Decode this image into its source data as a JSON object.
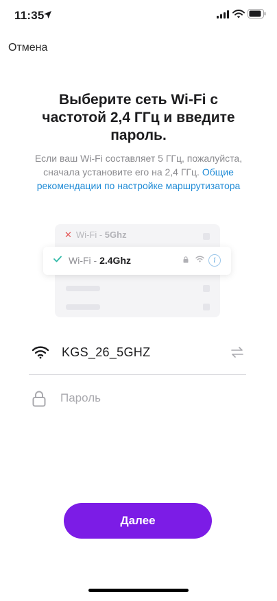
{
  "status_bar": {
    "time": "11:35"
  },
  "nav": {
    "cancel_label": "Отмена"
  },
  "header": {
    "title": "Выберите сеть Wi-Fi с частотой 2,4 ГГц и введите пароль.",
    "subtitle_text": "Если ваш Wi-Fi составляет 5 ГГц, пожалуйста, сначала установите его на 2,4 ГГц.",
    "subtitle_link": "Общие рекомендации по настройке маршрутизатора"
  },
  "illustration": {
    "bad_prefix": "Wi-Fi - ",
    "bad_band": "5Ghz",
    "good_prefix": "Wi-Fi - ",
    "good_band": "2.4Ghz",
    "info_glyph": "i",
    "colors": {
      "bad_mark": "#e35454",
      "good_mark": "#2fb9a7"
    }
  },
  "form": {
    "ssid": "KGS_26_5GHZ",
    "password_value": "",
    "password_placeholder": "Пароль"
  },
  "actions": {
    "next_label": "Далее"
  },
  "colors": {
    "accent": "#7c1ce6",
    "link": "#1f8bd6"
  }
}
